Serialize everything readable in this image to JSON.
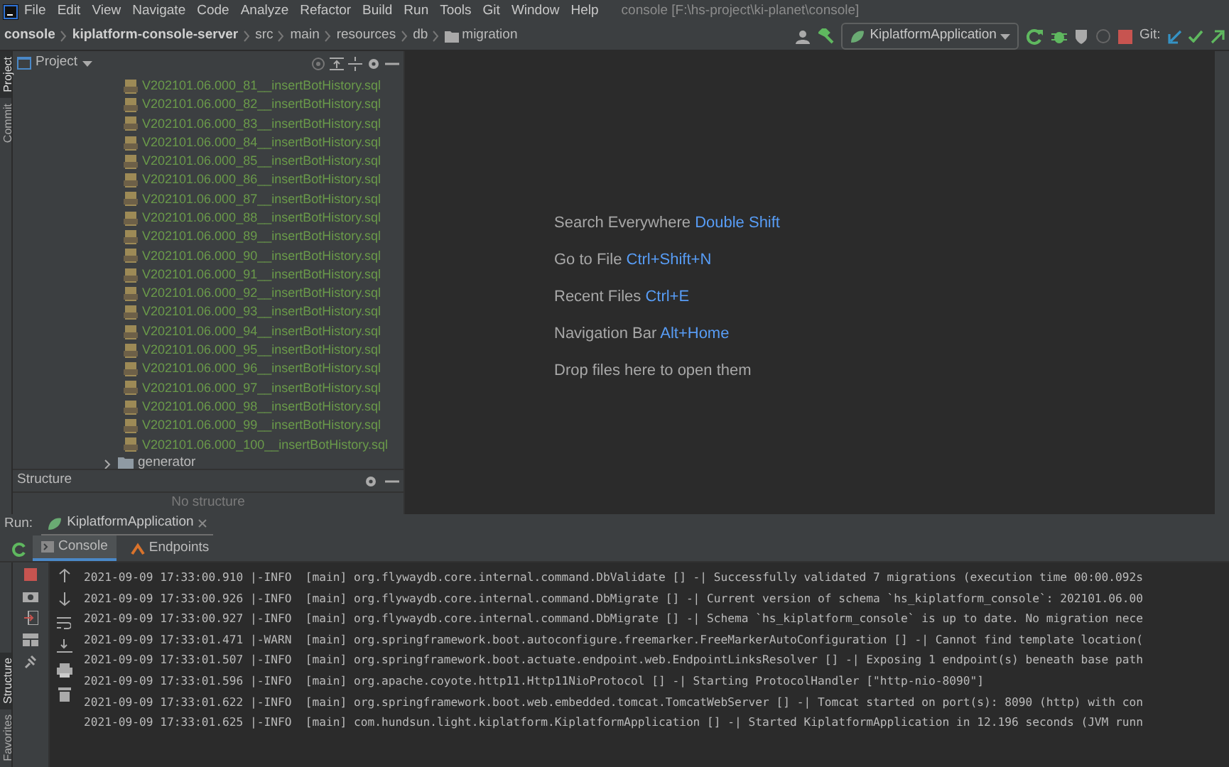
{
  "window": {
    "menu": [
      "File",
      "Edit",
      "View",
      "Navigate",
      "Code",
      "Analyze",
      "Refactor",
      "Build",
      "Run",
      "Tools",
      "Git",
      "Window",
      "Help"
    ],
    "title": "console [F:\\hs-project\\ki-planet\\console]"
  },
  "breadcrumb": [
    "console",
    "kiplatform-console-server",
    "src",
    "main",
    "resources",
    "db",
    "migration"
  ],
  "toolbar": {
    "run_config": "KiplatformApplication",
    "git_label": "Git:"
  },
  "left_strip": {
    "top": [
      "Project",
      "Commit"
    ],
    "bottom": [
      "Structure",
      "Favorites"
    ]
  },
  "project": {
    "title": "Project",
    "files": [
      "V202101.06.000_81__insertBotHistory.sql",
      "V202101.06.000_82__insertBotHistory.sql",
      "V202101.06.000_83__insertBotHistory.sql",
      "V202101.06.000_84__insertBotHistory.sql",
      "V202101.06.000_85__insertBotHistory.sql",
      "V202101.06.000_86__insertBotHistory.sql",
      "V202101.06.000_87__insertBotHistory.sql",
      "V202101.06.000_88__insertBotHistory.sql",
      "V202101.06.000_89__insertBotHistory.sql",
      "V202101.06.000_90__insertBotHistory.sql",
      "V202101.06.000_91__insertBotHistory.sql",
      "V202101.06.000_92__insertBotHistory.sql",
      "V202101.06.000_93__insertBotHistory.sql",
      "V202101.06.000_94__insertBotHistory.sql",
      "V202101.06.000_95__insertBotHistory.sql",
      "V202101.06.000_96__insertBotHistory.sql",
      "V202101.06.000_97__insertBotHistory.sql",
      "V202101.06.000_98__insertBotHistory.sql",
      "V202101.06.000_99__insertBotHistory.sql",
      "V202101.06.000_100__insertBotHistory.sql"
    ],
    "folder": {
      "name": "generator",
      "expanded": false
    }
  },
  "structure": {
    "title": "Structure",
    "empty_text": "No structure"
  },
  "editor_hints": [
    {
      "action": "Search Everywhere",
      "shortcut": "Double Shift"
    },
    {
      "action": "Go to File",
      "shortcut": "Ctrl+Shift+N"
    },
    {
      "action": "Recent Files",
      "shortcut": "Ctrl+E"
    },
    {
      "action": "Navigation Bar",
      "shortcut": "Alt+Home"
    },
    {
      "action": "Drop files here to open them"
    }
  ],
  "run": {
    "label": "Run:",
    "tab": "KiplatformApplication",
    "subtabs": [
      {
        "label": "Console",
        "selected": true
      },
      {
        "label": "Endpoints",
        "selected": false
      }
    ],
    "log": [
      "2021-09-09 17:33:00.910 |-INFO  [main] org.flywaydb.core.internal.command.DbValidate [] -| Successfully validated 7 migrations (execution time 00:00.092s",
      "2021-09-09 17:33:00.926 |-INFO  [main] org.flywaydb.core.internal.command.DbMigrate [] -| Current version of schema `hs_kiplatform_console`: 202101.06.00",
      "2021-09-09 17:33:00.927 |-INFO  [main] org.flywaydb.core.internal.command.DbMigrate [] -| Schema `hs_kiplatform_console` is up to date. No migration nece",
      "2021-09-09 17:33:01.471 |-WARN  [main] org.springframework.boot.autoconfigure.freemarker.FreeMarkerAutoConfiguration [] -| Cannot find template location(",
      "2021-09-09 17:33:01.507 |-INFO  [main] org.springframework.boot.actuate.endpoint.web.EndpointLinksResolver [] -| Exposing 1 endpoint(s) beneath base path",
      "2021-09-09 17:33:01.596 |-INFO  [main] org.apache.coyote.http11.Http11NioProtocol [] -| Starting ProtocolHandler [\"http-nio-8090\"]",
      "2021-09-09 17:33:01.622 |-INFO  [main] org.springframework.boot.web.embedded.tomcat.TomcatWebServer [] -| Tomcat started on port(s): 8090 (http) with con",
      "2021-09-09 17:33:01.625 |-INFO  [main] com.hundsun.light.kiplatform.KiplatformApplication [] -| Started KiplatformApplication in 12.196 seconds (JVM runn"
    ]
  }
}
